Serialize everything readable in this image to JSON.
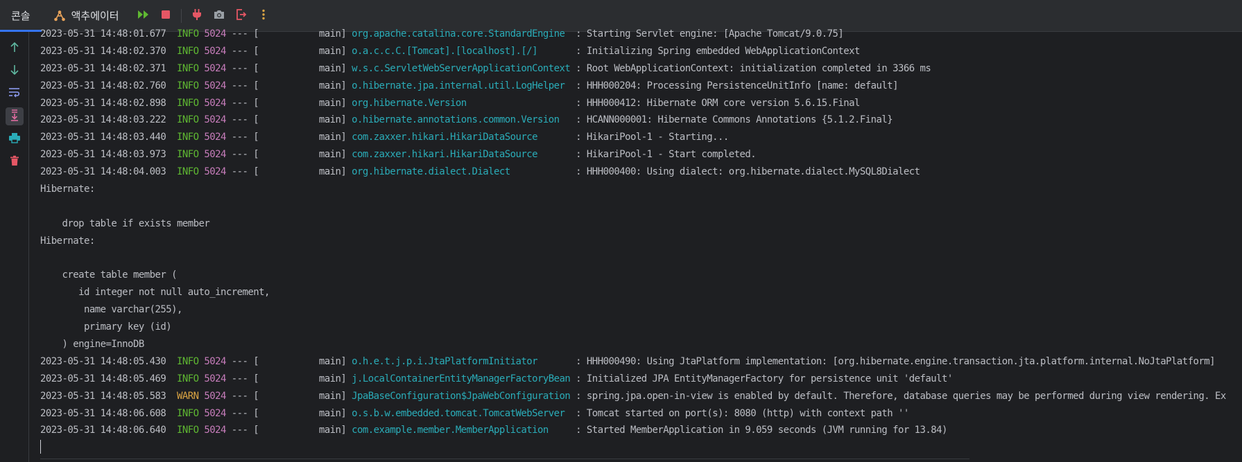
{
  "tabs": [
    {
      "id": "console",
      "label": "콘솔",
      "active": true
    },
    {
      "id": "actuator",
      "label": "액추에이터",
      "icon": "actuator-icon",
      "active": false
    }
  ],
  "toolbar": {
    "buttons": [
      {
        "name": "resume-icon",
        "color": "#5fb832"
      },
      {
        "name": "stop-icon",
        "color": "#e55765"
      },
      {
        "name": "plug-icon",
        "color": "#e55765"
      },
      {
        "name": "camera-icon",
        "color": "#9aa0a6"
      },
      {
        "name": "exit-icon",
        "color": "#e55765"
      },
      {
        "name": "more-vertical-icon",
        "color": "#d9a343"
      }
    ]
  },
  "gutter": {
    "buttons": [
      {
        "name": "arrow-up-icon",
        "color": "#5fb8a0"
      },
      {
        "name": "arrow-down-icon",
        "color": "#5fb8a0"
      },
      {
        "name": "soft-wrap-icon",
        "color": "#8c9cf0"
      },
      {
        "name": "scroll-to-end-icon",
        "color": "#e06c9f",
        "selected": true
      },
      {
        "name": "print-icon",
        "color": "#2aacb8"
      },
      {
        "name": "trash-icon",
        "color": "#e55765"
      }
    ]
  },
  "console": {
    "lines": [
      {
        "type": "log",
        "date": "2023-05-31 14:48:01.677",
        "level": "INFO",
        "pid": "5024",
        "sep": " --- [",
        "thread": "           main] ",
        "logger": "org.apache.catalina.core.StandardEngine ",
        "message": " : Starting Servlet engine: [Apache Tomcat/9.0.75]"
      },
      {
        "type": "log",
        "date": "2023-05-31 14:48:02.370",
        "level": "INFO",
        "pid": "5024",
        "sep": " --- [",
        "thread": "           main] ",
        "logger": "o.a.c.c.C.[Tomcat].[localhost].[/]      ",
        "message": " : Initializing Spring embedded WebApplicationContext"
      },
      {
        "type": "log",
        "date": "2023-05-31 14:48:02.371",
        "level": "INFO",
        "pid": "5024",
        "sep": " --- [",
        "thread": "           main] ",
        "logger": "w.s.c.ServletWebServerApplicationContext",
        "message": " : Root WebApplicationContext: initialization completed in 3366 ms"
      },
      {
        "type": "log",
        "date": "2023-05-31 14:48:02.760",
        "level": "INFO",
        "pid": "5024",
        "sep": " --- [",
        "thread": "           main] ",
        "logger": "o.hibernate.jpa.internal.util.LogHelper ",
        "message": " : HHH000204: Processing PersistenceUnitInfo [name: default]"
      },
      {
        "type": "log",
        "date": "2023-05-31 14:48:02.898",
        "level": "INFO",
        "pid": "5024",
        "sep": " --- [",
        "thread": "           main] ",
        "logger": "org.hibernate.Version                   ",
        "message": " : HHH000412: Hibernate ORM core version 5.6.15.Final"
      },
      {
        "type": "log",
        "date": "2023-05-31 14:48:03.222",
        "level": "INFO",
        "pid": "5024",
        "sep": " --- [",
        "thread": "           main] ",
        "logger": "o.hibernate.annotations.common.Version  ",
        "message": " : HCANN000001: Hibernate Commons Annotations {5.1.2.Final}"
      },
      {
        "type": "log",
        "date": "2023-05-31 14:48:03.440",
        "level": "INFO",
        "pid": "5024",
        "sep": " --- [",
        "thread": "           main] ",
        "logger": "com.zaxxer.hikari.HikariDataSource      ",
        "message": " : HikariPool-1 - Starting..."
      },
      {
        "type": "log",
        "date": "2023-05-31 14:48:03.973",
        "level": "INFO",
        "pid": "5024",
        "sep": " --- [",
        "thread": "           main] ",
        "logger": "com.zaxxer.hikari.HikariDataSource      ",
        "message": " : HikariPool-1 - Start completed."
      },
      {
        "type": "log",
        "date": "2023-05-31 14:48:04.003",
        "level": "INFO",
        "pid": "5024",
        "sep": " --- [",
        "thread": "           main] ",
        "logger": "org.hibernate.dialect.Dialect           ",
        "message": " : HHH000400: Using dialect: org.hibernate.dialect.MySQL8Dialect"
      },
      {
        "type": "plain",
        "text": "Hibernate: "
      },
      {
        "type": "plain",
        "text": ""
      },
      {
        "type": "plain",
        "text": "    drop table if exists member"
      },
      {
        "type": "plain",
        "text": "Hibernate: "
      },
      {
        "type": "plain",
        "text": ""
      },
      {
        "type": "plain",
        "text": "    create table member ("
      },
      {
        "type": "plain",
        "text": "       id integer not null auto_increment,"
      },
      {
        "type": "plain",
        "text": "        name varchar(255),"
      },
      {
        "type": "plain",
        "text": "        primary key (id)"
      },
      {
        "type": "plain",
        "text": "    ) engine=InnoDB"
      },
      {
        "type": "log",
        "date": "2023-05-31 14:48:05.430",
        "level": "INFO",
        "pid": "5024",
        "sep": " --- [",
        "thread": "           main] ",
        "logger": "o.h.e.t.j.p.i.JtaPlatformInitiator      ",
        "message": " : HHH000490: Using JtaPlatform implementation: [org.hibernate.engine.transaction.jta.platform.internal.NoJtaPlatform]"
      },
      {
        "type": "log",
        "date": "2023-05-31 14:48:05.469",
        "level": "INFO",
        "pid": "5024",
        "sep": " --- [",
        "thread": "           main] ",
        "logger": "j.LocalContainerEntityManagerFactoryBean",
        "message": " : Initialized JPA EntityManagerFactory for persistence unit 'default'"
      },
      {
        "type": "log",
        "date": "2023-05-31 14:48:05.583",
        "level": "WARN",
        "pid": "5024",
        "sep": " --- [",
        "thread": "           main] ",
        "logger": "JpaBaseConfiguration$JpaWebConfiguration",
        "message": " : spring.jpa.open-in-view is enabled by default. Therefore, database queries may be performed during view rendering. Ex"
      },
      {
        "type": "log",
        "date": "2023-05-31 14:48:06.608",
        "level": "INFO",
        "pid": "5024",
        "sep": " --- [",
        "thread": "           main] ",
        "logger": "o.s.b.w.embedded.tomcat.TomcatWebServer ",
        "message": " : Tomcat started on port(s): 8080 (http) with context path ''"
      },
      {
        "type": "log",
        "date": "2023-05-31 14:48:06.640",
        "level": "INFO",
        "pid": "5024",
        "sep": " --- [",
        "thread": "           main] ",
        "logger": "com.example.member.MemberApplication    ",
        "message": " : Started MemberApplication in 9.059 seconds (JVM running for 13.84)"
      }
    ]
  }
}
